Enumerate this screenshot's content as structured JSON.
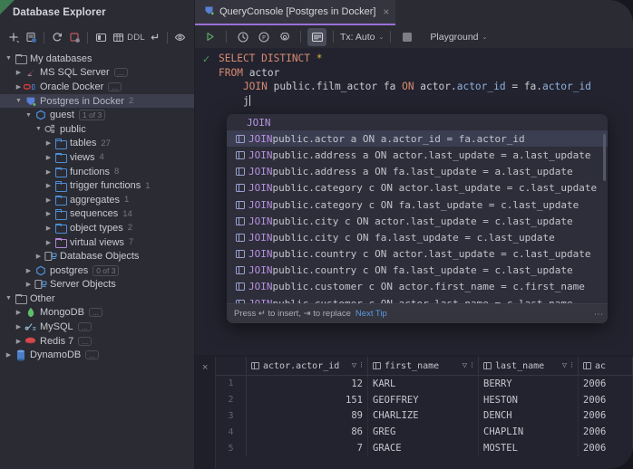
{
  "sidebar": {
    "title": "Database Explorer",
    "toolbar": [
      {
        "name": "add-icon",
        "glyph": "+"
      },
      {
        "name": "database-properties-icon",
        "glyph": "db"
      },
      {
        "name": "refresh-icon",
        "glyph": "⟳"
      },
      {
        "name": "stop-refresh-icon",
        "glyph": "sq"
      },
      {
        "name": "open-console-icon",
        "glyph": "console"
      },
      {
        "name": "data-editor-icon",
        "glyph": "grid"
      },
      {
        "name": "ddl-icon",
        "glyph": "DDL"
      },
      {
        "name": "jump-to-source-icon",
        "glyph": "↵"
      },
      {
        "name": "preview-icon",
        "glyph": "👁"
      }
    ],
    "tree": [
      {
        "label": "My databases",
        "indent": 0,
        "chev": "down",
        "icon": "folder-grey",
        "count": "",
        "badge": "",
        "dots": false,
        "selected": false
      },
      {
        "label": "MS SQL Server",
        "indent": 1,
        "chev": "right",
        "icon": "mssql",
        "count": "",
        "badge": "",
        "dots": true,
        "selected": false
      },
      {
        "label": "Oracle Docker",
        "indent": 1,
        "chev": "right",
        "icon": "oracle",
        "count": "",
        "badge": "",
        "dots": true,
        "selected": false
      },
      {
        "label": "Postgres in Docker",
        "indent": 1,
        "chev": "down",
        "icon": "postgres",
        "count": "2",
        "badge": "",
        "dots": false,
        "selected": true
      },
      {
        "label": "guest",
        "indent": 2,
        "chev": "down",
        "icon": "db",
        "count": "",
        "badge": "1 of 3",
        "dots": false,
        "selected": false
      },
      {
        "label": "public",
        "indent": 3,
        "chev": "down",
        "icon": "schema",
        "count": "",
        "badge": "",
        "dots": false,
        "selected": false
      },
      {
        "label": "tables",
        "indent": 4,
        "chev": "right",
        "icon": "folder-blue",
        "count": "27",
        "badge": "",
        "dots": false,
        "selected": false
      },
      {
        "label": "views",
        "indent": 4,
        "chev": "right",
        "icon": "folder-blue",
        "count": "4",
        "badge": "",
        "dots": false,
        "selected": false
      },
      {
        "label": "functions",
        "indent": 4,
        "chev": "right",
        "icon": "folder-blue",
        "count": "8",
        "badge": "",
        "dots": false,
        "selected": false
      },
      {
        "label": "trigger functions",
        "indent": 4,
        "chev": "right",
        "icon": "folder-blue",
        "count": "1",
        "badge": "",
        "dots": false,
        "selected": false
      },
      {
        "label": "aggregates",
        "indent": 4,
        "chev": "right",
        "icon": "folder-blue",
        "count": "1",
        "badge": "",
        "dots": false,
        "selected": false
      },
      {
        "label": "sequences",
        "indent": 4,
        "chev": "right",
        "icon": "folder-blue",
        "count": "14",
        "badge": "",
        "dots": false,
        "selected": false
      },
      {
        "label": "object types",
        "indent": 4,
        "chev": "right",
        "icon": "folder-blue",
        "count": "2",
        "badge": "",
        "dots": false,
        "selected": false
      },
      {
        "label": "virtual views",
        "indent": 4,
        "chev": "right",
        "icon": "folder-purple",
        "count": "7",
        "badge": "",
        "dots": false,
        "selected": false
      },
      {
        "label": "Database Objects",
        "indent": 3,
        "chev": "right",
        "icon": "objects",
        "count": "",
        "badge": "",
        "dots": false,
        "selected": false
      },
      {
        "label": "postgres",
        "indent": 2,
        "chev": "right",
        "icon": "db",
        "count": "",
        "badge": "0 of 3",
        "dots": false,
        "selected": false
      },
      {
        "label": "Server Objects",
        "indent": 2,
        "chev": "right",
        "icon": "objects",
        "count": "",
        "badge": "",
        "dots": false,
        "selected": false
      },
      {
        "label": "Other",
        "indent": 0,
        "chev": "down",
        "icon": "folder-grey",
        "count": "",
        "badge": "",
        "dots": false,
        "selected": false
      },
      {
        "label": "MongoDB",
        "indent": 1,
        "chev": "right",
        "icon": "mongo",
        "count": "",
        "badge": "",
        "dots": true,
        "selected": false
      },
      {
        "label": "MySQL",
        "indent": 1,
        "chev": "right",
        "icon": "mysql",
        "count": "",
        "badge": "",
        "dots": true,
        "selected": false
      },
      {
        "label": "Redis 7",
        "indent": 1,
        "chev": "right",
        "icon": "redis",
        "count": "",
        "badge": "",
        "dots": true,
        "selected": false
      },
      {
        "label": "DynamoDB",
        "indent": 0,
        "chev": "right",
        "icon": "dynamo",
        "count": "",
        "badge": "",
        "dots": true,
        "selected": false
      }
    ]
  },
  "editor": {
    "tab": {
      "label": "QueryConsole [Postgres in Docker]",
      "close": "×",
      "icon": "postgres-icon"
    },
    "toolbar": {
      "run": "▷",
      "history": "history-icon",
      "explain": "explain-icon",
      "settings": "gear-icon",
      "output": "output-icon",
      "tx_label": "Tx: Auto",
      "stop": "stop-icon",
      "schema_label": "Playground",
      "caret": "⌄"
    },
    "gutter_status": "✓",
    "code_lines": [
      {
        "parts": [
          {
            "t": "SELECT DISTINCT ",
            "c": "kw"
          },
          {
            "t": "*",
            "c": "star"
          }
        ]
      },
      {
        "parts": [
          {
            "t": "FROM ",
            "c": "kw"
          },
          {
            "t": "actor",
            "c": "ident"
          }
        ]
      },
      {
        "parts": [
          {
            "t": "    JOIN ",
            "c": "kw"
          },
          {
            "t": "public.film_actor fa ",
            "c": "ident"
          },
          {
            "t": "ON ",
            "c": "kw"
          },
          {
            "t": "actor.",
            "c": "ident"
          },
          {
            "t": "actor_id",
            "c": "col"
          },
          {
            "t": " = fa.",
            "c": "ident"
          },
          {
            "t": "actor_id",
            "c": "col"
          }
        ]
      },
      {
        "parts": [
          {
            "t": "    j",
            "c": "ident"
          }
        ]
      }
    ]
  },
  "autocomplete": {
    "header": "JOIN",
    "items": [
      {
        "kw": "JOIN",
        "rest": " public.actor a ON a.actor_id = fa.actor_id",
        "selected": true
      },
      {
        "kw": "JOIN",
        "rest": " public.address a ON actor.last_update = a.last_update",
        "selected": false
      },
      {
        "kw": "JOIN",
        "rest": " public.address a ON fa.last_update = a.last_update",
        "selected": false
      },
      {
        "kw": "JOIN",
        "rest": " public.category c ON actor.last_update = c.last_update",
        "selected": false
      },
      {
        "kw": "JOIN",
        "rest": " public.category c ON fa.last_update = c.last_update",
        "selected": false
      },
      {
        "kw": "JOIN",
        "rest": " public.city c ON actor.last_update = c.last_update",
        "selected": false
      },
      {
        "kw": "JOIN",
        "rest": " public.city c ON fa.last_update = c.last_update",
        "selected": false
      },
      {
        "kw": "JOIN",
        "rest": " public.country c ON actor.last_update = c.last_update",
        "selected": false
      },
      {
        "kw": "JOIN",
        "rest": " public.country c ON fa.last_update = c.last_update",
        "selected": false
      },
      {
        "kw": "JOIN",
        "rest": " public.customer c ON actor.first_name = c.first_name",
        "selected": false
      },
      {
        "kw": "JOIN",
        "rest": " public.customer c ON actor.last_name = c.last_name",
        "selected": false
      }
    ],
    "footer": {
      "hint": "Press ↵ to insert, ⇥ to replace",
      "link": "Next Tip",
      "menu": "⋮"
    }
  },
  "result": {
    "close": "×",
    "columns": [
      {
        "label": "actor.actor_id",
        "filter": "▽",
        "sorter": "⁝"
      },
      {
        "label": "first_name",
        "filter": "▽",
        "sorter": "⁝"
      },
      {
        "label": "last_name",
        "filter": "▽",
        "sorter": "⁝"
      },
      {
        "label": "ac",
        "filter": "",
        "sorter": ""
      }
    ],
    "rows": [
      {
        "n": "1",
        "actor_id": "12",
        "first_name": "KARL",
        "last_name": "BERRY",
        "last_update": "2006"
      },
      {
        "n": "2",
        "actor_id": "151",
        "first_name": "GEOFFREY",
        "last_name": "HESTON",
        "last_update": "2006"
      },
      {
        "n": "3",
        "actor_id": "89",
        "first_name": "CHARLIZE",
        "last_name": "DENCH",
        "last_update": "2006"
      },
      {
        "n": "4",
        "actor_id": "86",
        "first_name": "GREG",
        "last_name": "CHAPLIN",
        "last_update": "2006"
      },
      {
        "n": "5",
        "actor_id": "7",
        "first_name": "GRACE",
        "last_name": "MOSTEL",
        "last_update": "2006"
      }
    ]
  },
  "colors": {
    "accent_tab": "#9a6fd8",
    "keyword": "#d98a73",
    "column": "#8fb0e0",
    "selection": "#3b3d51",
    "link": "#5b9ade"
  }
}
